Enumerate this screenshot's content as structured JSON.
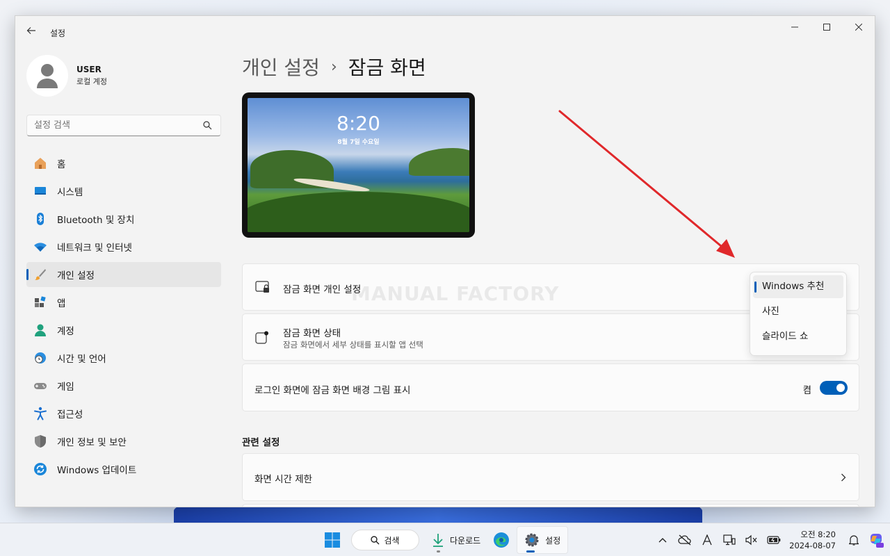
{
  "window": {
    "title": "설정"
  },
  "user": {
    "name": "USER",
    "account_type": "로컬 계정"
  },
  "search": {
    "placeholder": "설정 검색"
  },
  "nav": [
    {
      "label": "홈",
      "icon": "home-icon"
    },
    {
      "label": "시스템",
      "icon": "system-icon"
    },
    {
      "label": "Bluetooth 및 장치",
      "icon": "bluetooth-icon"
    },
    {
      "label": "네트워크 및 인터넷",
      "icon": "network-icon"
    },
    {
      "label": "개인 설정",
      "icon": "brush-icon",
      "active": true
    },
    {
      "label": "앱",
      "icon": "apps-icon"
    },
    {
      "label": "계정",
      "icon": "account-icon"
    },
    {
      "label": "시간 및 언어",
      "icon": "globe-clock-icon"
    },
    {
      "label": "게임",
      "icon": "gamepad-icon"
    },
    {
      "label": "접근성",
      "icon": "accessibility-icon"
    },
    {
      "label": "개인 정보 및 보안",
      "icon": "shield-icon"
    },
    {
      "label": "Windows 업데이트",
      "icon": "update-icon"
    }
  ],
  "breadcrumb": {
    "parent": "개인 설정",
    "separator": "›",
    "current": "잠금 화면"
  },
  "lock_preview": {
    "time": "8:20",
    "date": "8월 7일 수요일"
  },
  "settings": {
    "personalize": {
      "title": "잠금 화면 개인 설정",
      "options": [
        "Windows 추천",
        "사진",
        "슬라이드 쇼"
      ],
      "selected": "Windows 추천"
    },
    "status": {
      "title": "잠금 화면 상태",
      "subtitle": "잠금 화면에서 세부 상태를 표시할 앱 선택"
    },
    "signin_bg": {
      "title": "로그인 화면에 잠금 화면 배경 그림 표시",
      "state_label": "켬",
      "on": true
    }
  },
  "watermark": "MANUAL FACTORY",
  "related": {
    "heading": "관련 설정",
    "items": [
      {
        "label": "화면 시간 제한"
      }
    ]
  },
  "taskbar": {
    "search_label": "검색",
    "download_label": "다운로드",
    "settings_label": "설정",
    "clock": {
      "time": "오전 8:20",
      "date": "2024-08-07"
    }
  },
  "colors": {
    "accent": "#005fb8",
    "annotation_arrow": "#e0282b"
  }
}
